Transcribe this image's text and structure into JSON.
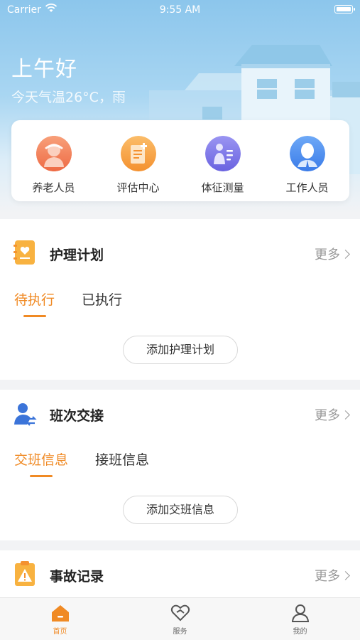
{
  "status_bar": {
    "carrier": "Carrier",
    "time": "9:55 AM"
  },
  "header": {
    "greeting": "上午好",
    "weather": "今天气温26°C，雨"
  },
  "quick_menu": [
    {
      "label": "养老人员",
      "icon": "elderly-person-icon",
      "color": "#f07a55"
    },
    {
      "label": "评估中心",
      "icon": "assessment-doc-icon",
      "color": "#f7a349"
    },
    {
      "label": "体征测量",
      "icon": "vital-signs-icon",
      "color": "#7c77e8"
    },
    {
      "label": "工作人员",
      "icon": "staff-person-icon",
      "color": "#4a8cf0"
    }
  ],
  "sections": {
    "care_plan": {
      "title": "护理计划",
      "more": "更多",
      "tabs": [
        "待执行",
        "已执行"
      ],
      "active_tab": 0,
      "add_label": "添加护理计划"
    },
    "shift_handover": {
      "title": "班次交接",
      "more": "更多",
      "tabs": [
        "交班信息",
        "接班信息"
      ],
      "active_tab": 0,
      "add_label": "添加交班信息"
    },
    "incident": {
      "title": "事故记录",
      "more": "更多"
    }
  },
  "tab_bar": [
    {
      "label": "首页",
      "icon": "home-icon",
      "active": true
    },
    {
      "label": "服务",
      "icon": "heart-icon",
      "active": false
    },
    {
      "label": "我的",
      "icon": "profile-icon",
      "active": false
    }
  ],
  "colors": {
    "accent": "#f08a24",
    "header_sky": "#8cc6ec"
  }
}
